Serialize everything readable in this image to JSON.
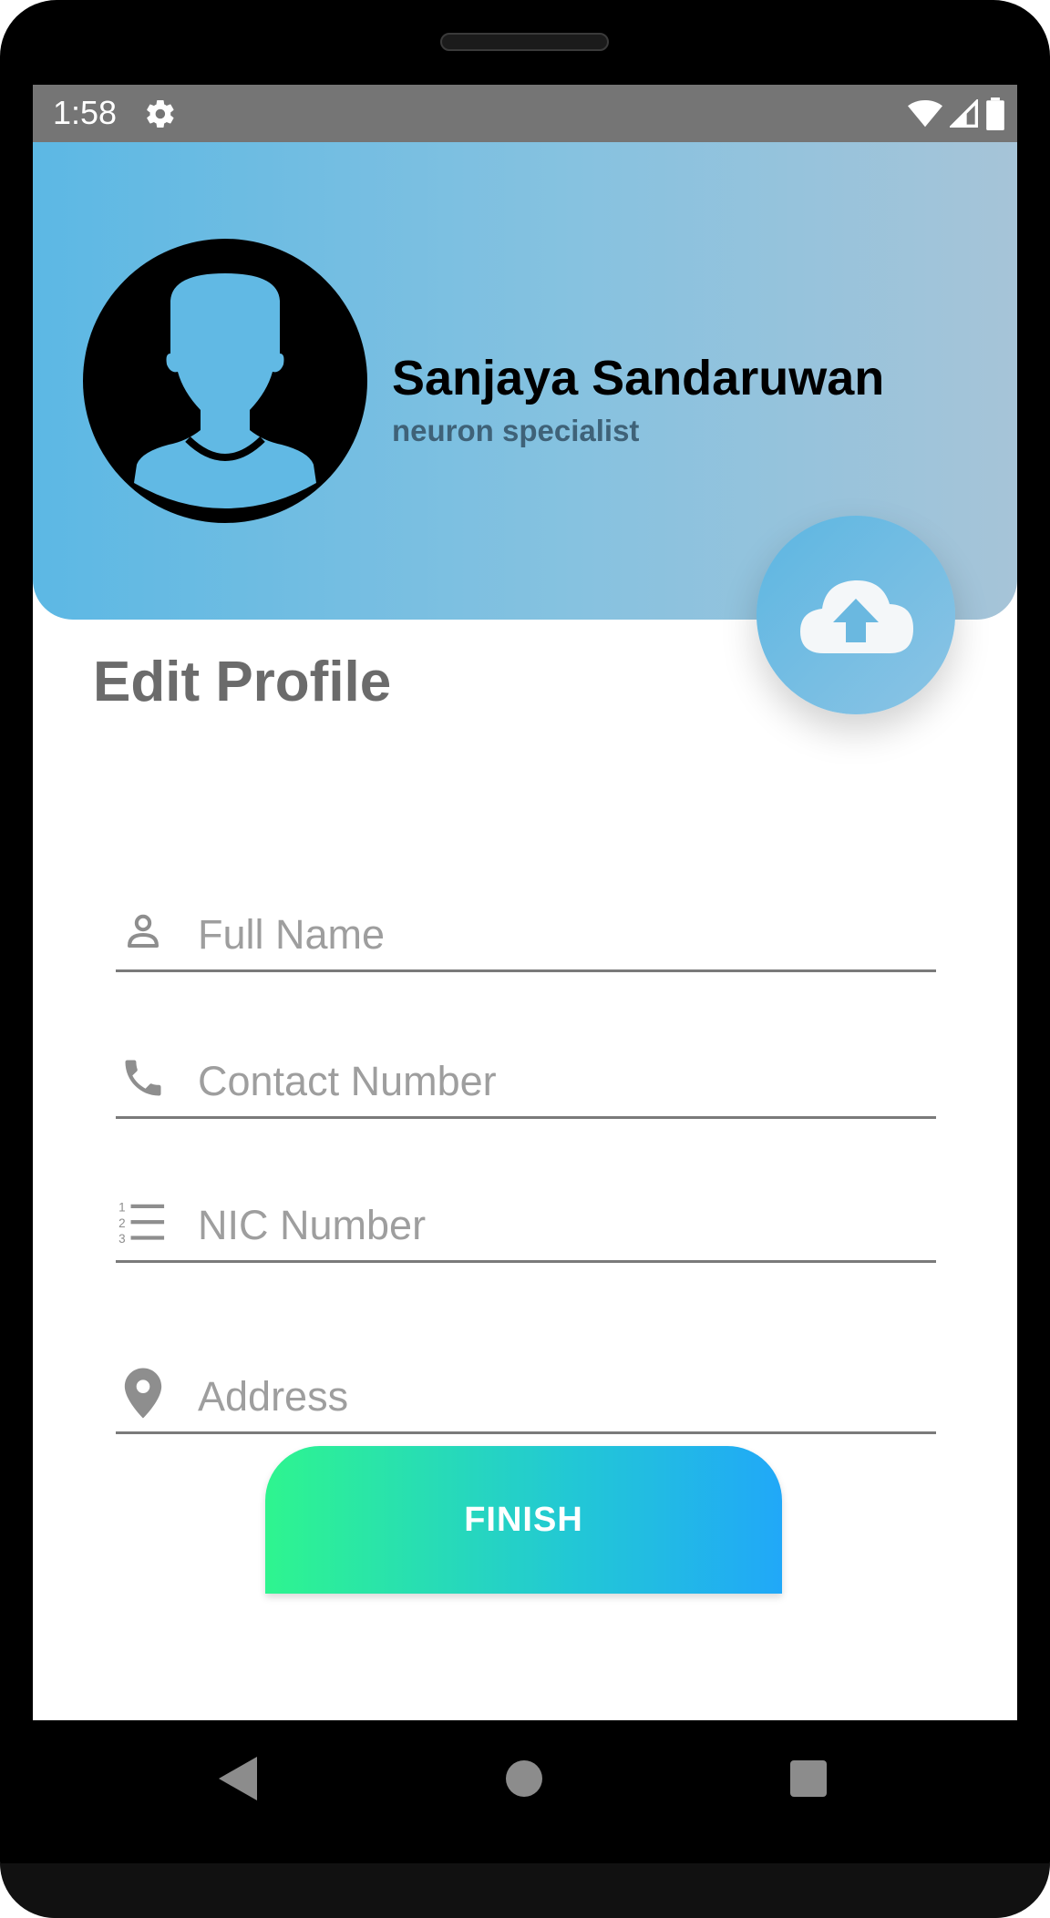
{
  "status_bar": {
    "time": "1:58",
    "icons": [
      "gear-icon",
      "wifi-icon",
      "signal-icon",
      "battery-icon"
    ]
  },
  "profile": {
    "name": "Sanjaya Sandaruwan",
    "role": "neuron specialist",
    "avatar_icon": "person-silhouette-icon",
    "upload_icon": "cloud-upload-icon"
  },
  "page": {
    "title": "Edit Profile"
  },
  "form": {
    "fields": [
      {
        "placeholder": "Full Name",
        "value": "",
        "icon": "person-icon"
      },
      {
        "placeholder": "Contact Number",
        "value": "",
        "icon": "phone-icon"
      },
      {
        "placeholder": "NIC Number",
        "value": "",
        "icon": "numbered-list-icon"
      },
      {
        "placeholder": "Address",
        "value": "",
        "icon": "location-pin-icon"
      }
    ],
    "submit_label": "FINISH"
  },
  "navigation": {
    "buttons": [
      "back-icon",
      "home-icon",
      "recents-icon"
    ]
  },
  "colors": {
    "header_start": "#5cb8e4",
    "header_end": "#a6c4d8",
    "button_start": "#2ef58f",
    "button_end": "#21a8f8",
    "title_text": "#6b6b6b",
    "role_text": "#3f6278"
  }
}
